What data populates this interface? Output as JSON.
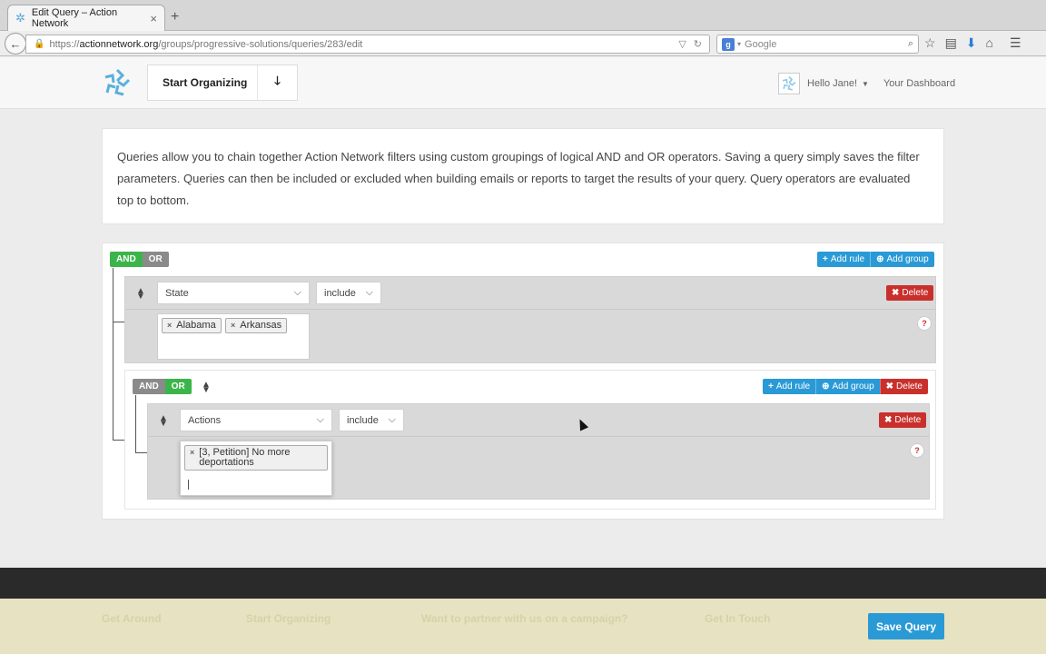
{
  "browser": {
    "tab_title": "Edit Query – Action Network",
    "new_tab": "+",
    "url_host": "actionnetwork.org",
    "url_prefix": "https://",
    "url_path": "/groups/progressive-solutions/queries/283/edit",
    "search_placeholder": "Google"
  },
  "header": {
    "start_organizing": "Start Organizing",
    "greeting": "Hello Jane!",
    "dashboard": "Your Dashboard"
  },
  "info_text": "Queries allow you to chain together Action Network filters using custom groupings of logical AND and OR operators. Saving a query simply saves the filter parameters. Queries can then be included or excluded when building emails or reports to target the results of your query. Query operators are evaluated top to bottom.",
  "builder": {
    "root_toggle": {
      "and": "AND",
      "or": "OR",
      "active": "AND"
    },
    "add_rule": "Add rule",
    "add_group": "Add group",
    "delete": "Delete",
    "rule1": {
      "field": "State",
      "operator": "include",
      "values": [
        "Alabama",
        "Arkansas"
      ],
      "help": "?"
    },
    "group": {
      "toggle": {
        "and": "AND",
        "or": "OR",
        "active": "OR"
      },
      "rule": {
        "field": "Actions",
        "operator": "include",
        "values": [
          "[3, Petition] No more deportations"
        ],
        "help": "?"
      }
    }
  },
  "footer": {
    "columns": [
      "Get Around",
      "Start Organizing",
      "Want to partner with us on a campaign?",
      "Get In Touch"
    ],
    "save_button": "Save Query"
  },
  "colors": {
    "accent_blue": "#2a9ad6",
    "danger_red": "#c9302c",
    "toggle_green": "#3bb54a"
  }
}
